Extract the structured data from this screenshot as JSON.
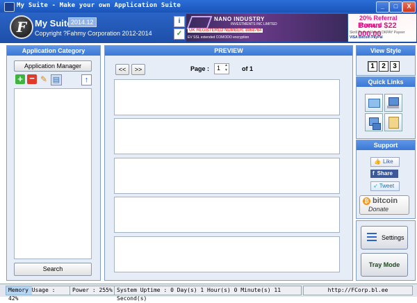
{
  "window": {
    "title": "My Suite - Make your own Application Suite",
    "controls": [
      "_",
      "□",
      "X"
    ]
  },
  "header": {
    "logo_letter": "F",
    "app_name": "My Suite",
    "version": "2014.12",
    "copyright": "Copyright ?Fahmy Corporation 2012-2014",
    "info_icon": "i",
    "shield_icon": "✓"
  },
  "ads": {
    "banner1": {
      "title": "NANO INDUSTRY",
      "subtitle": "INVESTMENTS INC LIMITED",
      "registered": "UK REGISTERED NUMBER: 8968764",
      "ssl": "EV SSL extended COMODO encryption"
    },
    "banner2": {
      "line1": "20% Referral Reward",
      "line2": "Bonus $22 000.00",
      "line3": "Skrill Perfect Money OKPAY Payeer",
      "line4": "VISA Bitcoin PayPal"
    }
  },
  "left_panel": {
    "title": "Application Category",
    "manager_button": "Application Manager",
    "search_button": "Search",
    "toolbar": [
      {
        "name": "add-icon",
        "glyph": "+"
      },
      {
        "name": "remove-icon",
        "glyph": "−"
      },
      {
        "name": "edit-icon",
        "glyph": "✎"
      },
      {
        "name": "copy-icon",
        "glyph": "▤"
      },
      {
        "name": "up-arrow-icon",
        "glyph": "↑"
      }
    ]
  },
  "preview": {
    "title": "PREVIEW",
    "prev_label": "<<",
    "next_label": ">>",
    "page_label": "Page :",
    "page_value": "1",
    "page_total": "of 1"
  },
  "right_panel": {
    "view_style_title": "View Style",
    "view_buttons": [
      "1",
      "2",
      "3"
    ],
    "quick_links_title": "Quick Links",
    "support_title": "Support",
    "like_label": "Like",
    "share_label": "Share",
    "tweet_label": "Tweet",
    "bitcoin_label": "bitcoin",
    "donate_label": "Donate",
    "settings_label": "Settings",
    "tray_label": "Tray Mode"
  },
  "status": {
    "memory": "Memory Usage : 42%",
    "memory_level": 0.42,
    "power": "Power : 255%",
    "uptime": "System Uptime : 0 Day(s) 1 Hour(s) 0 Minute(s) 11 Second(s)",
    "url": "http://FCorp.bl.ee"
  },
  "colors": {
    "title_bar": "#1f5cc4",
    "panel_title": "#4a86e0",
    "ad_banner": "#5a3a7c",
    "bonus_text": "#e0148a"
  }
}
